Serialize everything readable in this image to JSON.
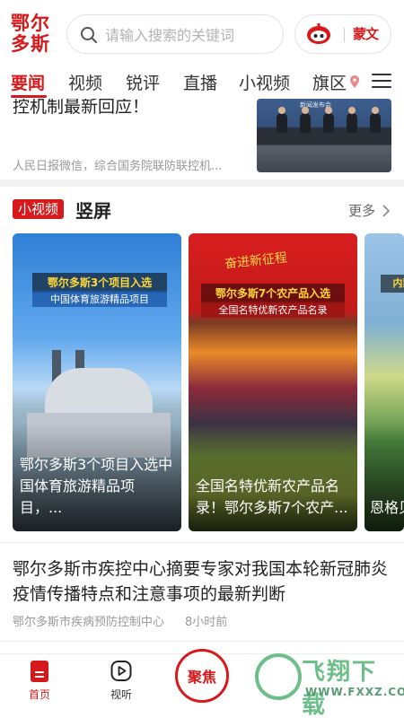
{
  "header": {
    "logo_text": "鄂尔多斯",
    "search_placeholder": "请输入搜索的关键词",
    "calligraphy_text": "蒙文"
  },
  "tabs": [
    {
      "label": "要闻",
      "active": true
    },
    {
      "label": "视频",
      "active": false
    },
    {
      "label": "锐评",
      "active": false
    },
    {
      "label": "直播",
      "active": false
    },
    {
      "label": "小视频",
      "active": false
    },
    {
      "label": "旗区",
      "active": false
    }
  ],
  "top_article": {
    "title": "控机制最新回应！",
    "source": "人民日报微信，综合国务院联防联控机...",
    "thumb_banner": "新闻发布会"
  },
  "short_video": {
    "badge": "小视频",
    "title": "竖屏",
    "more_label": "更多",
    "cards": [
      {
        "banner": "鄂尔多斯3个项目入选",
        "sub": "中国体育旅游精品项目",
        "caption": "鄂尔多斯3个项目入选中国体育旅游精品项目，...",
        "slogan": ""
      },
      {
        "banner": "鄂尔多斯7个农产品入选",
        "sub": "全国名特优新农产品名录",
        "caption": "全国名特优新农产品名录！鄂尔多斯7个农产...",
        "slogan": "奋进新征程"
      },
      {
        "banner": "内蒙古",
        "sub": "",
        "caption": "恩格贝生态治理",
        "slogan": ""
      }
    ]
  },
  "article": {
    "title": "鄂尔多斯市疾控中心摘要专家对我国本轮新冠肺炎疫情传播特点和注意事项的最新判断",
    "source": "鄂尔多斯市疾病预防控制中心",
    "time": "8小时前"
  },
  "bottom_nav": {
    "home_label": "首页",
    "listen_label": "视听",
    "focus_label": "聚焦"
  },
  "watermark": {
    "text": "飞翔下载",
    "url": "WWW.FXXZ.COM"
  },
  "colors": {
    "accent": "#d7191b",
    "muted": "#999999"
  }
}
